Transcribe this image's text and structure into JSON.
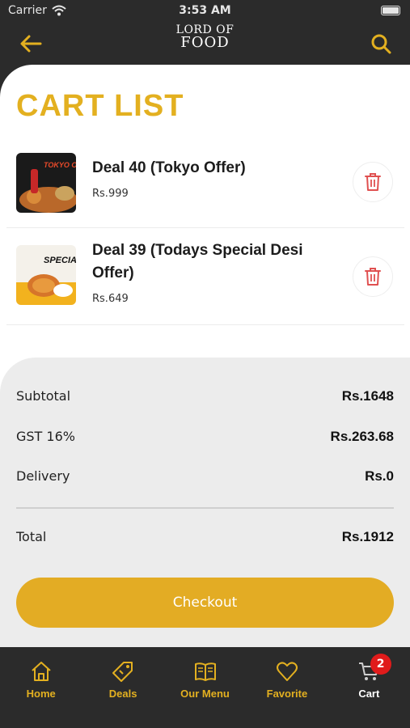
{
  "status_bar": {
    "carrier": "Carrier",
    "time": "3:53 AM"
  },
  "header": {
    "logo_line1": "LORD OF",
    "logo_line2": "FOOD",
    "back_icon": "arrow-left-icon",
    "search_icon": "search-icon"
  },
  "page_title": "CART LIST",
  "cart": {
    "items": [
      {
        "name": "Deal 40 (Tokyo Offer)",
        "price": "Rs.999",
        "thumb_text": "TOKYO OFFER"
      },
      {
        "name": "Deal 39 (Todays Special Desi Offer)",
        "price": "Rs.649",
        "thumb_text": "SPECIAL"
      }
    ]
  },
  "summary": {
    "subtotal_label": "Subtotal",
    "subtotal_value": "Rs.1648",
    "gst_label": "GST 16%",
    "gst_value": "Rs.263.68",
    "delivery_label": "Delivery",
    "delivery_value": "Rs.0",
    "total_label": "Total",
    "total_value": "Rs.1912"
  },
  "checkout_label": "Checkout",
  "tabs": [
    {
      "label": "Home",
      "icon": "home-icon"
    },
    {
      "label": "Deals",
      "icon": "tag-icon"
    },
    {
      "label": "Our Menu",
      "icon": "menu-book-icon"
    },
    {
      "label": "Favorite",
      "icon": "heart-icon"
    },
    {
      "label": "Cart",
      "icon": "cart-icon",
      "badge": "2",
      "active": true
    }
  ],
  "colors": {
    "accent": "#e3b020",
    "dark": "#2b2b2b",
    "delete": "#e05050",
    "badge": "#e01b1b"
  }
}
